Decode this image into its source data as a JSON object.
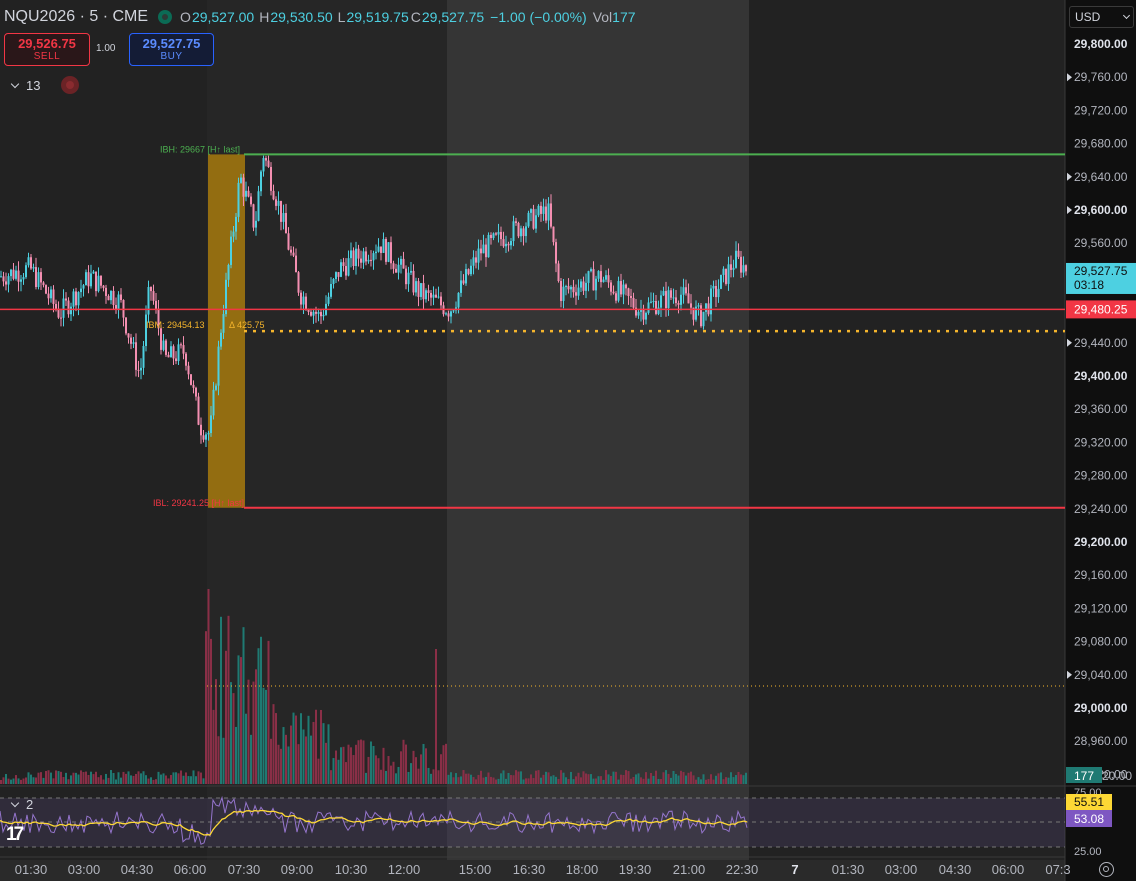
{
  "header": {
    "symbol": "NQU2026 · 5 · CME",
    "open_label": "O",
    "open": "29,527.00",
    "high_label": "H",
    "high": "29,530.50",
    "low_label": "L",
    "low": "29,519.75",
    "close_label": "C",
    "close": "29,527.75",
    "change": "−1.00 (−0.00%)",
    "vol_label": "Vol",
    "vol": "177"
  },
  "trade": {
    "sell_price": "29,526.75",
    "sell_label": "SELL",
    "quantity": "1.00",
    "buy_price": "29,527.75",
    "buy_label": "BUY"
  },
  "indicators_toggle": {
    "count": "13"
  },
  "oscillator_toggle": {
    "count": "2"
  },
  "currency": "USD",
  "annotations": {
    "ibh": "IBH: 29667 [H↑ last]",
    "ibl": "IBL: 29241.25 [H↑ last]",
    "ibm": "IBM: 29454.13",
    "range": "Δ 425.75"
  },
  "price_axis": {
    "ticks": [
      "29,800.00",
      "29,760.00",
      "29,720.00",
      "29,680.00",
      "29,640.00",
      "29,600.00",
      "29,560.00",
      "29,440.00",
      "29,400.00",
      "29,360.00",
      "29,320.00",
      "29,280.00",
      "29,240.00",
      "29,200.00",
      "29,160.00",
      "29,120.00",
      "29,080.00",
      "29,040.00",
      "29,000.00",
      "28,960.00",
      "28,920.00"
    ],
    "bold_ticks": [
      "29,800.00",
      "29,600.00",
      "29,400.00",
      "29,200.00",
      "29,000.00"
    ],
    "last_price_label": "29,527.75",
    "countdown": "03:18",
    "level_label": "29,480.25",
    "volume_label": "177"
  },
  "osc_axis": {
    "top": "75.00",
    "bottom": "25.00",
    "value1": "55.51",
    "value2": "53.08"
  },
  "time_axis": [
    "01:30",
    "03:00",
    "04:30",
    "06:00",
    "07:30",
    "09:00",
    "10:30",
    "12:00",
    "15:00",
    "16:30",
    "18:00",
    "19:30",
    "21:00",
    "22:30",
    "7",
    "01:30",
    "03:00",
    "04:30",
    "06:00",
    "07:3"
  ],
  "colors": {
    "up": "#4dd0e1",
    "down": "#f48fb1",
    "ibh": "#4caf50",
    "ibl": "#f23645",
    "ibm": "#f5b52c",
    "ib_box": "#b8860b",
    "osc_line": "#9575cd",
    "osc_signal": "#fdd835"
  },
  "chart_data": {
    "type": "candlestick",
    "series": [
      {
        "name": "IBH",
        "value": 29667
      },
      {
        "name": "IBL",
        "value": 29241.25
      },
      {
        "name": "IBM",
        "value": 29454.13
      }
    ],
    "y_range": [
      28920,
      29800
    ],
    "last_price": 29527.75,
    "level": 29480.25,
    "oscillator_range": [
      25,
      75
    ],
    "oscillator_values": [
      55.51,
      53.08
    ],
    "last_volume": 177
  }
}
